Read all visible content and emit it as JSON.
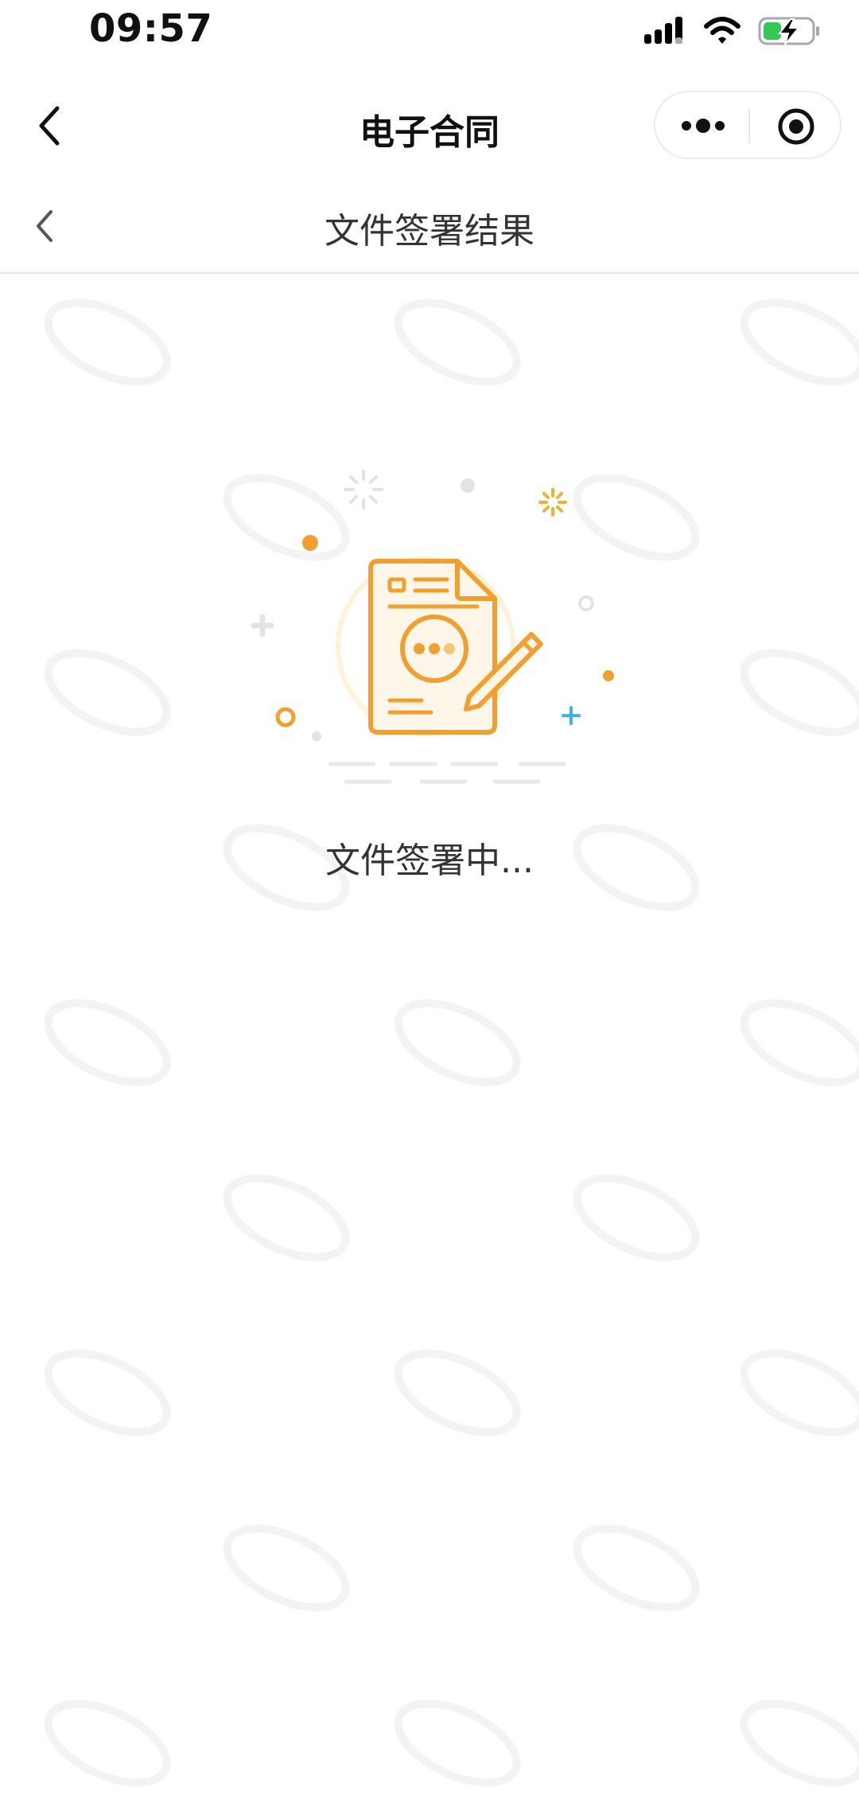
{
  "status_bar": {
    "time": "09:57"
  },
  "nav": {
    "title": "电子合同"
  },
  "sub_header": {
    "title": "文件签署结果"
  },
  "main": {
    "status_text": "文件签署中..."
  },
  "colors": {
    "accent": "#F0A030",
    "accent_light": "#FFF4E3",
    "plus_blue": "#3CB4E6",
    "battery_green": "#34C759"
  }
}
